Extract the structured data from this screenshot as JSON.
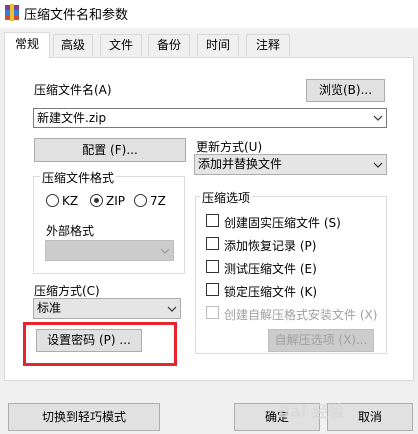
{
  "window": {
    "title": "压缩文件名和参数",
    "app_icon": "winrar-icon"
  },
  "tabs": [
    {
      "label": "常规",
      "active": true
    },
    {
      "label": "高级",
      "active": false
    },
    {
      "label": "文件",
      "active": false
    },
    {
      "label": "备份",
      "active": false
    },
    {
      "label": "时间",
      "active": false
    },
    {
      "label": "注释",
      "active": false
    }
  ],
  "archive_name": {
    "label": "压缩文件名(A)",
    "browse_label": "浏览(B)...",
    "value": "新建文件.zip"
  },
  "profiles_label": "配置 (F)...",
  "update_mode": {
    "label": "更新方式(U)",
    "value": "添加并替换文件"
  },
  "archive_format": {
    "title": "压缩文件格式",
    "options": [
      {
        "label": "KZ",
        "checked": false
      },
      {
        "label": "ZIP",
        "checked": true
      },
      {
        "label": "7Z",
        "checked": false
      }
    ],
    "external_label": "外部格式"
  },
  "archive_options": {
    "title": "压缩选项",
    "items": [
      {
        "label": "创建固实压缩文件 (S)",
        "checked": false,
        "enabled": true
      },
      {
        "label": "添加恢复记录 (P)",
        "checked": false,
        "enabled": true
      },
      {
        "label": "测试压缩文件 (E)",
        "checked": false,
        "enabled": true
      },
      {
        "label": "锁定压缩文件 (K)",
        "checked": false,
        "enabled": true
      },
      {
        "label": "创建自解压格式安装文件 (X)",
        "checked": false,
        "enabled": false
      }
    ],
    "sfx_options_label": "自解压选项 (X)..."
  },
  "compression_method": {
    "label": "压缩方式(C)",
    "value": "标准"
  },
  "set_password_label": "设置密码 (P) ...",
  "footer": {
    "switch_mode_label": "切换到轻巧模式",
    "ok_label": "确定",
    "cancel_label": "取消"
  },
  "watermark": "Bai 经验",
  "colors": {
    "highlight": "#e8242c",
    "panel": "#ffffff",
    "dialog": "#f0f0f0"
  }
}
